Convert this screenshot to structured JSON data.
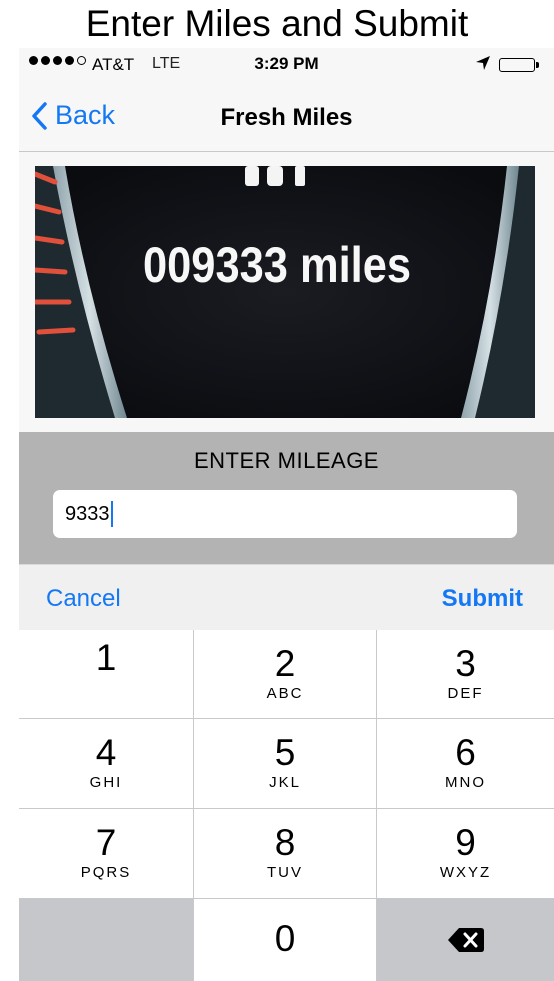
{
  "caption": "Enter Miles  and Submit",
  "status_bar": {
    "carrier": "AT&T",
    "network": "LTE",
    "time": "3:29 PM",
    "icons": [
      "signal-dots-icon",
      "location-arrow-icon",
      "battery-icon"
    ]
  },
  "nav": {
    "back_label": "Back",
    "title": "Fresh Miles"
  },
  "photo": {
    "readout": "009333 miles"
  },
  "entry": {
    "label": "ENTER MILEAGE",
    "value": "9333"
  },
  "toolbar": {
    "cancel_label": "Cancel",
    "submit_label": "Submit"
  },
  "keypad": {
    "keys": [
      {
        "num": "1",
        "letters": ""
      },
      {
        "num": "2",
        "letters": "ABC"
      },
      {
        "num": "3",
        "letters": "DEF"
      },
      {
        "num": "4",
        "letters": "GHI"
      },
      {
        "num": "5",
        "letters": "JKL"
      },
      {
        "num": "6",
        "letters": "MNO"
      },
      {
        "num": "7",
        "letters": "PQRS"
      },
      {
        "num": "8",
        "letters": "TUV"
      },
      {
        "num": "9",
        "letters": "WXYZ"
      },
      {
        "num": "0",
        "letters": ""
      }
    ]
  },
  "colors": {
    "accent": "#1478f5",
    "keypad_bg": "#c8c9cd",
    "entry_bg": "#b3b3b3"
  }
}
